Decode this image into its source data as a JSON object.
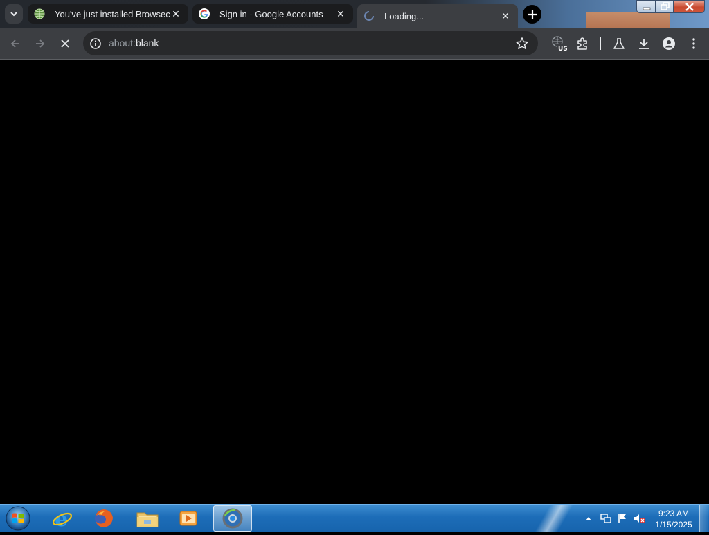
{
  "browser": {
    "tabs": [
      {
        "title": "You've just installed Browsec!",
        "favicon": "globe-icon",
        "active": false
      },
      {
        "title": "Sign in - Google Accounts",
        "favicon": "google-g-icon",
        "active": false
      },
      {
        "title": "Loading...",
        "favicon": "loading-spinner-icon",
        "active": true
      }
    ],
    "close_glyph": "✕",
    "address_bar": {
      "scheme": "about:",
      "host": "blank"
    }
  },
  "taskbar": {
    "apps": [
      {
        "name": "internet-explorer",
        "icon": "ie-icon"
      },
      {
        "name": "firefox",
        "icon": "firefox-icon"
      },
      {
        "name": "file-explorer",
        "icon": "folder-icon"
      },
      {
        "name": "media-player",
        "icon": "media-player-icon"
      },
      {
        "name": "chrome",
        "icon": "chrome-icon",
        "active": true
      }
    ],
    "clock": {
      "time": "9:23 AM",
      "date": "1/15/2025"
    }
  },
  "colors": {
    "tab_strip": "#24282e",
    "toolbar": "#3c3e42",
    "omnibox": "#28292b",
    "content": "#000000",
    "taskbar": "#1d6db8"
  }
}
